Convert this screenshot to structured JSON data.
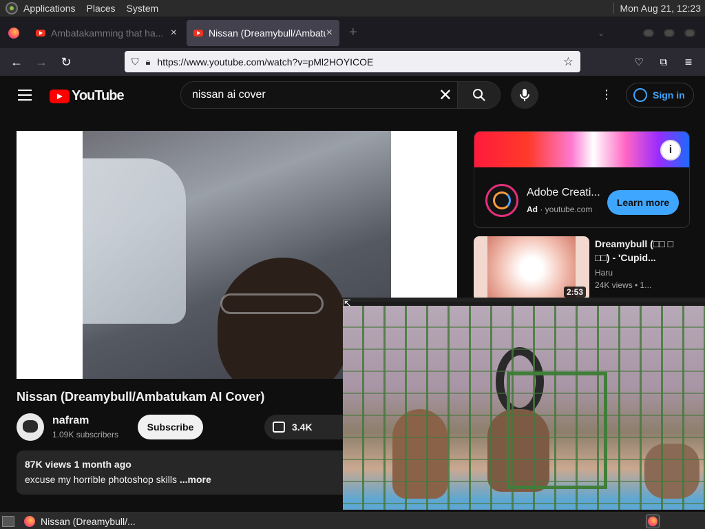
{
  "os_panel": {
    "menus": [
      "Applications",
      "Places",
      "System"
    ],
    "clock": "Mon Aug 21, 12:23"
  },
  "browser": {
    "tabs": [
      {
        "title": "Ambatakamming that ha...",
        "active": false
      },
      {
        "title": "Nissan (Dreamybull/Ambatu",
        "active": true
      }
    ],
    "url": "https://www.youtube.com/watch?v=pMl2HOYICOE",
    "icons": {
      "back": "arrow-left-icon",
      "forward": "arrow-right-icon",
      "reload": "reload-icon",
      "shield": "shield-icon",
      "lock": "lock-icon",
      "bookmark": "star-icon",
      "pocket": "pocket-icon",
      "extensions": "puzzle-icon",
      "menu": "hamburger-icon"
    }
  },
  "youtube": {
    "logo_text": "YouTube",
    "search_query": "nissan ai cover",
    "signin_label": "Sign in",
    "video": {
      "title": "Nissan (Dreamybull/Ambatukam AI Cover)",
      "channel": "nafram",
      "subscribers": "1.09K subscribers",
      "subscribe_label": "Subscribe",
      "likes": "3.4K",
      "views_date": "87K views  1 month ago",
      "description": "excuse my horrible photoshop skills",
      "more_label": "...more"
    },
    "ad": {
      "title": "Adobe Creati...",
      "badge": "Ad",
      "domain": "youtube.com",
      "cta": "Learn more"
    },
    "recommendation": {
      "title": "Dreamybull (□□ □ □□) - 'Cupid...",
      "channel": "Haru",
      "meta": "24K views  • 1...",
      "duration": "2:53"
    }
  },
  "taskbar": {
    "window_title": "Nissan (Dreamybull/..."
  },
  "colors": {
    "youtube_red": "#ff0000",
    "link_blue": "#3ea6ff",
    "bg": "#0f0f0f"
  }
}
